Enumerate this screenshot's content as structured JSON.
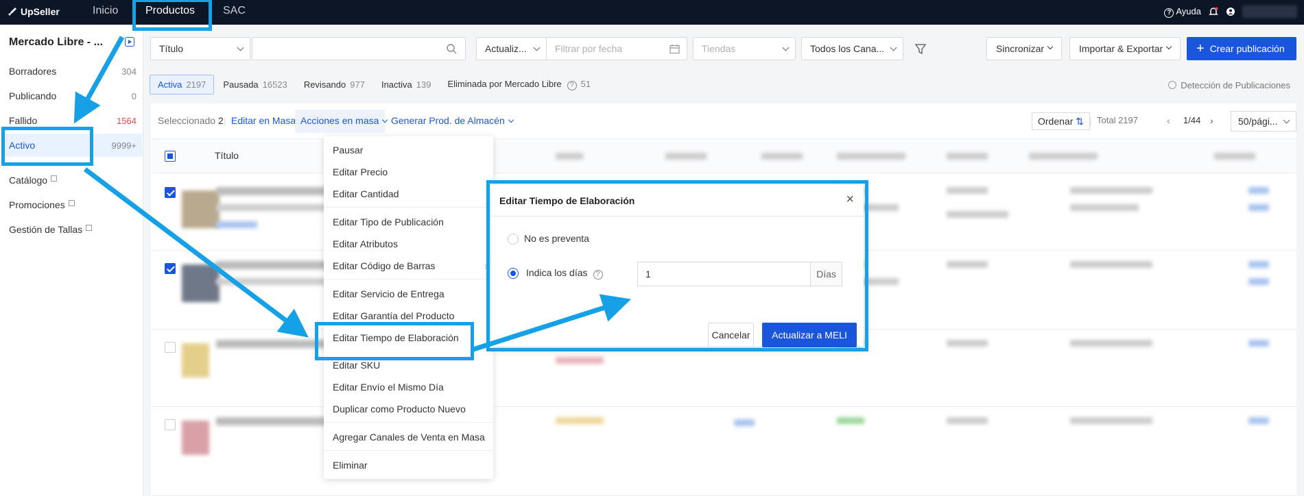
{
  "app": {
    "logo": "UpSeller"
  },
  "topnav": {
    "items": [
      "Inicio",
      "Productos",
      "SAC"
    ],
    "help": "Ayuda"
  },
  "sidebar": {
    "title": "Mercado Libre - ...",
    "items": [
      {
        "label": "Borradores",
        "count": "304"
      },
      {
        "label": "Publicando",
        "count": "0"
      },
      {
        "label": "Fallido",
        "count": "1564"
      },
      {
        "label": "Activo",
        "count": "9999+"
      }
    ],
    "links": [
      "Catálogo",
      "Promociones",
      "Gestión de Tallas"
    ]
  },
  "filters": {
    "field_select": "Título",
    "date_type": "Actualiz...",
    "date_placeholder": "Filtrar por fecha",
    "stores_placeholder": "Tiendas",
    "channels": "Todos los Cana..."
  },
  "actions": {
    "sync": "Sincronizar",
    "import_export": "Importar & Exportar",
    "create": "Crear publicación"
  },
  "tabs": [
    {
      "label": "Activa",
      "count": "2197"
    },
    {
      "label": "Pausada",
      "count": "16523"
    },
    {
      "label": "Revisando",
      "count": "977"
    },
    {
      "label": "Inactiva",
      "count": "139"
    },
    {
      "label": "Eliminada por Mercado Libre",
      "count": "51"
    }
  ],
  "detect_link": "Detección de Publicaciones",
  "toolbar": {
    "selected_label": "Seleccionado",
    "selected_count": "2",
    "bulk_edit": "Editar en Masa",
    "bulk_actions": "Acciones en masa",
    "generate": "Generar Prod. de Almacén",
    "sort": "Ordenar",
    "total": "Total 2197",
    "page": "1/44",
    "per_page": "50/pági..."
  },
  "table": {
    "title_header": "Título"
  },
  "menu": {
    "items": [
      "Pausar",
      "Editar Precio",
      "Editar Cantidad",
      "Editar Tipo de Publicación",
      "Editar Atributos",
      "Editar Código de Barras",
      "Editar Servicio de Entrega",
      "Editar Garantía del Producto",
      "Editar Tiempo de Elaboración",
      "Editar SKU",
      "Editar Envío el Mismo Día",
      "Duplicar como Producto Nuevo",
      "Agregar Canales de Venta en Masa",
      "Eliminar"
    ]
  },
  "modal": {
    "title": "Editar Tiempo de Elaboración",
    "option1": "No es preventa",
    "option2": "Indica los días",
    "days_value": "1",
    "days_unit": "Días",
    "cancel": "Cancelar",
    "submit": "Actualizar a MELI"
  },
  "colors": {
    "accent": "#1a56db",
    "highlight": "#16a1e6",
    "topbar": "#0d1626",
    "error": "#e5484d"
  }
}
